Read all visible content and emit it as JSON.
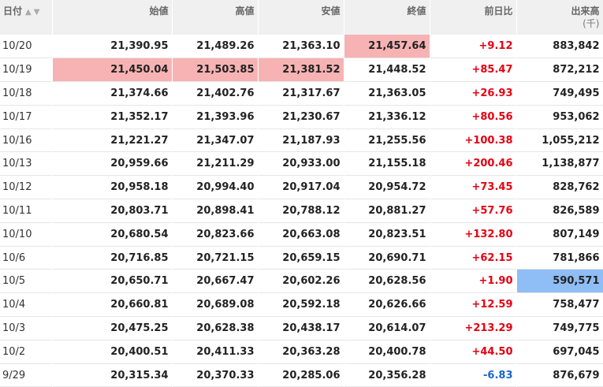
{
  "header": {
    "date": "日付",
    "open": "始値",
    "high": "高値",
    "low": "安値",
    "close": "終値",
    "change": "前日比",
    "volume": "出来高",
    "volume_unit": "(千)"
  },
  "rows": [
    {
      "date": "10/20",
      "open": "21,390.95",
      "high": "21,489.26",
      "low": "21,363.10",
      "close": "21,457.64",
      "change": "+9.12",
      "volume": "883,842"
    },
    {
      "date": "10/19",
      "open": "21,450.04",
      "high": "21,503.85",
      "low": "21,381.52",
      "close": "21,448.52",
      "change": "+85.47",
      "volume": "872,212"
    },
    {
      "date": "10/18",
      "open": "21,374.66",
      "high": "21,402.76",
      "low": "21,317.67",
      "close": "21,363.05",
      "change": "+26.93",
      "volume": "749,495"
    },
    {
      "date": "10/17",
      "open": "21,352.17",
      "high": "21,393.96",
      "low": "21,230.67",
      "close": "21,336.12",
      "change": "+80.56",
      "volume": "953,062"
    },
    {
      "date": "10/16",
      "open": "21,221.27",
      "high": "21,347.07",
      "low": "21,187.93",
      "close": "21,255.56",
      "change": "+100.38",
      "volume": "1,055,212"
    },
    {
      "date": "10/13",
      "open": "20,959.66",
      "high": "21,211.29",
      "low": "20,933.00",
      "close": "21,155.18",
      "change": "+200.46",
      "volume": "1,138,877"
    },
    {
      "date": "10/12",
      "open": "20,958.18",
      "high": "20,994.40",
      "low": "20,917.04",
      "close": "20,954.72",
      "change": "+73.45",
      "volume": "828,762"
    },
    {
      "date": "10/11",
      "open": "20,803.71",
      "high": "20,898.41",
      "low": "20,788.12",
      "close": "20,881.27",
      "change": "+57.76",
      "volume": "826,589"
    },
    {
      "date": "10/10",
      "open": "20,680.54",
      "high": "20,823.66",
      "low": "20,663.08",
      "close": "20,823.51",
      "change": "+132.80",
      "volume": "807,149"
    },
    {
      "date": "10/6",
      "open": "20,716.85",
      "high": "20,721.15",
      "low": "20,659.15",
      "close": "20,690.71",
      "change": "+62.15",
      "volume": "781,866"
    },
    {
      "date": "10/5",
      "open": "20,650.71",
      "high": "20,667.47",
      "low": "20,602.26",
      "close": "20,628.56",
      "change": "+1.90",
      "volume": "590,571"
    },
    {
      "date": "10/4",
      "open": "20,660.81",
      "high": "20,689.08",
      "low": "20,592.18",
      "close": "20,626.66",
      "change": "+12.59",
      "volume": "758,477"
    },
    {
      "date": "10/3",
      "open": "20,475.25",
      "high": "20,628.38",
      "low": "20,438.17",
      "close": "20,614.07",
      "change": "+213.29",
      "volume": "749,775"
    },
    {
      "date": "10/2",
      "open": "20,400.51",
      "high": "20,411.33",
      "low": "20,363.28",
      "close": "20,400.78",
      "change": "+44.50",
      "volume": "697,045"
    },
    {
      "date": "9/29",
      "open": "20,315.34",
      "high": "20,370.33",
      "low": "20,285.06",
      "close": "20,356.28",
      "change": "-6.83",
      "volume": "876,679"
    }
  ],
  "highlights": {
    "0": [
      "close"
    ],
    "1": [
      "open",
      "high",
      "low"
    ],
    "10": [
      "volume"
    ]
  },
  "colors": {
    "up": "#e60012",
    "down": "#1a66cc",
    "highlight_high": "#f7b3b3",
    "highlight_low": "#8fbdf5"
  },
  "icons": {
    "sort_asc": "▲",
    "sort_desc": "▼"
  }
}
